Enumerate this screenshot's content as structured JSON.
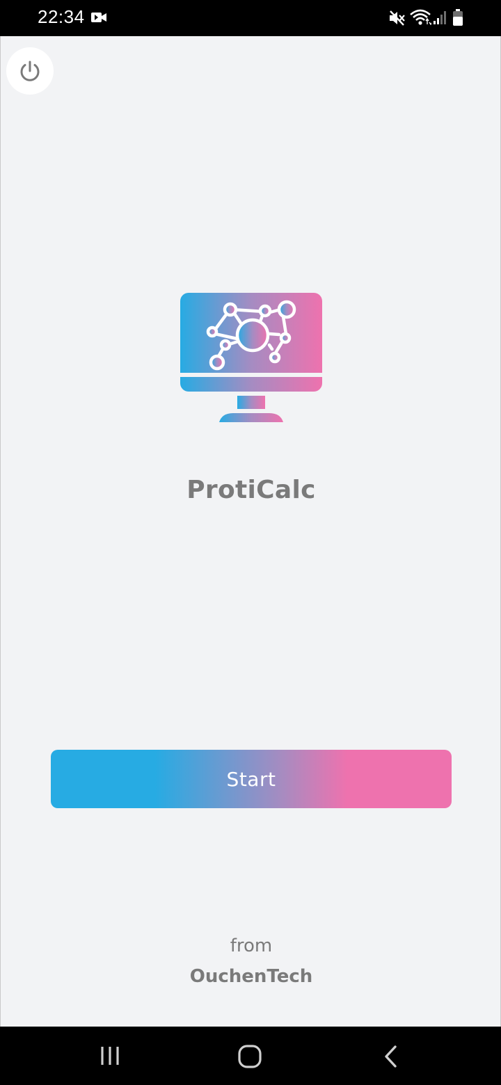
{
  "status_bar": {
    "time": "22:34",
    "icons": [
      "video-record-icon",
      "mute-icon",
      "wifi-icon",
      "signal-icon",
      "battery-icon"
    ]
  },
  "app": {
    "power_icon": "power-icon",
    "logo_icon": "monitor-network-icon",
    "name": "ProtiCalc",
    "start_label": "Start",
    "from_label": "from",
    "company": "OuchenTech"
  },
  "colors": {
    "background": "#f2f3f5",
    "gradient_start": "#27abe3",
    "gradient_end": "#ee72ae",
    "text_gray": "#7a7a7a"
  },
  "nav_bar": {
    "icons": [
      "recent-apps-icon",
      "home-icon",
      "back-icon"
    ]
  }
}
